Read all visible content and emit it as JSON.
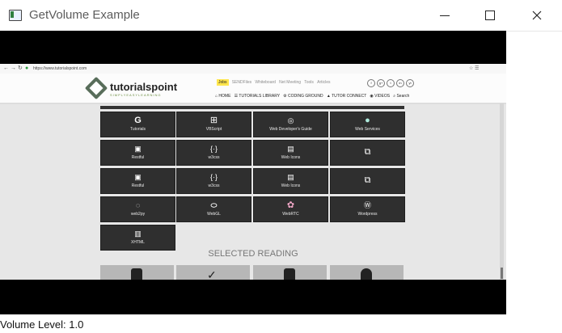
{
  "window": {
    "title": "GetVolume Example",
    "controls": [
      "minimize",
      "maximize",
      "close"
    ]
  },
  "browser": {
    "url": "https://www.tutorialspoint.com",
    "menu_icons": "☆ ☰"
  },
  "site": {
    "logo_text": "tutorialspoint",
    "tagline": "SIMPLYEASYLEARNING",
    "topbar_items": [
      "Jobs",
      "SENDFiles",
      "Whiteboard",
      "Net Meeting",
      "Tools",
      "Articles"
    ],
    "social": [
      "f",
      "g+",
      "t",
      "in",
      "yt"
    ],
    "nav_items": [
      "HOME",
      "TUTORIALS LIBRARY",
      "CODING GROUND",
      "TUTOR CONNECT",
      "VIDEOS",
      "Search"
    ]
  },
  "tiles": [
    [
      {
        "label": "Tutorials",
        "icon": "g-icon"
      },
      {
        "label": "VBScript",
        "icon": "windows-icon"
      },
      {
        "label": "Web Developer's Guide",
        "icon": "www-icon"
      },
      {
        "label": "Web Services",
        "icon": "web-services-icon"
      }
    ],
    [
      {
        "label": "Restful",
        "icon": "restful-icon"
      },
      {
        "label": "w3css",
        "icon": "w3css-icon"
      },
      {
        "label": "Web Icons",
        "icon": "web-icons-icon"
      },
      {
        "label": "",
        "icon": "photo-icon"
      }
    ],
    [
      {
        "label": "Restful",
        "icon": "restful-icon"
      },
      {
        "label": "w3css",
        "icon": "w3css-icon"
      },
      {
        "label": "Web Icons",
        "icon": "web-icons-icon"
      },
      {
        "label": "",
        "icon": "photo-icon"
      }
    ],
    [
      {
        "label": "web2py",
        "icon": "web2py-icon"
      },
      {
        "label": "WebGL",
        "icon": "webgl-icon"
      },
      {
        "label": "WebRTC",
        "icon": "webrtc-icon"
      },
      {
        "label": "Wordpress",
        "icon": "wordpress-icon"
      }
    ],
    [
      {
        "label": "XHTML",
        "icon": "xhtml-icon"
      }
    ]
  ],
  "selected_reading": "SELECTED READING",
  "volume": {
    "label": "Volume Level: 1.0",
    "value": 1.0
  },
  "colors": {
    "video_bg": "#000000",
    "tile_bg": "#2f2f2f",
    "page_bg": "#e7e7e7"
  }
}
